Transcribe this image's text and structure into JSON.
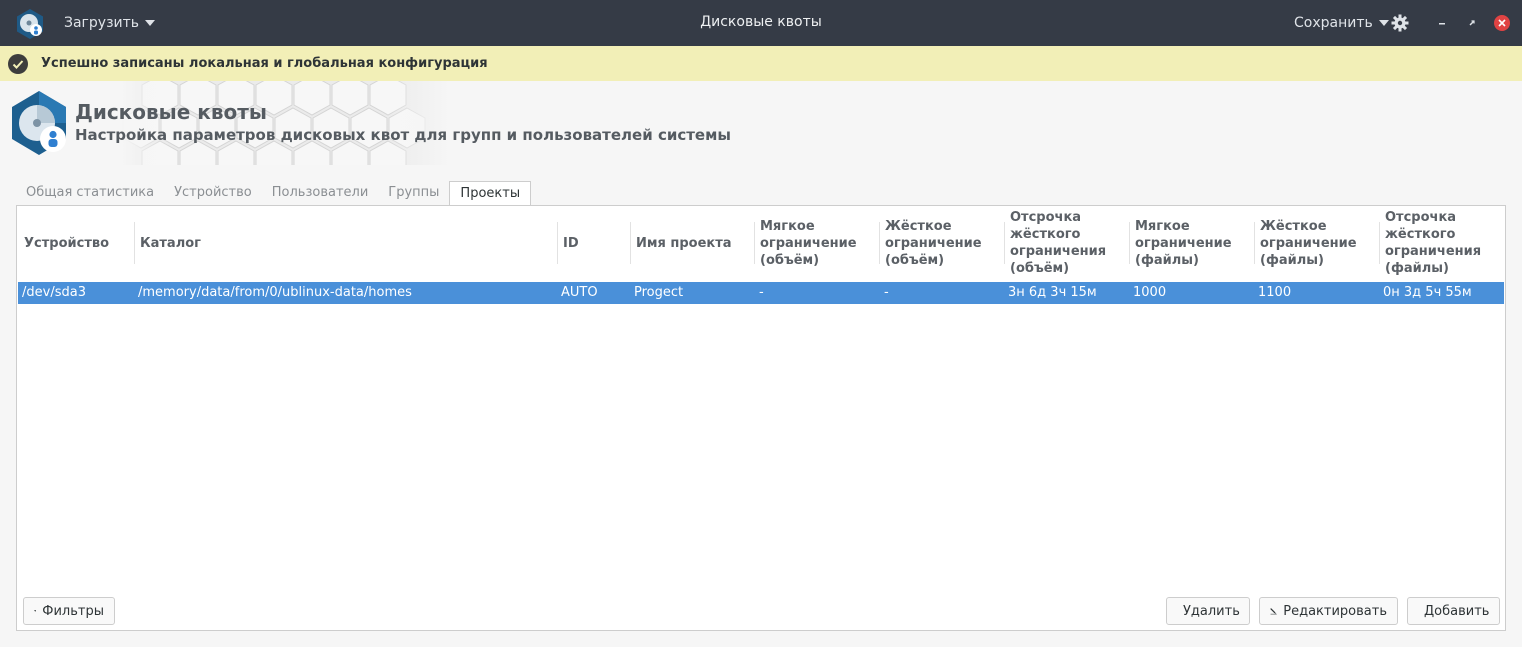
{
  "header": {
    "load_label": "Загрузить",
    "title": "Дисковые квоты",
    "save_label": "Сохранить"
  },
  "infobar": {
    "message": "Успешно записаны локальная и глобальная конфигурация"
  },
  "banner": {
    "title": "Дисковые квоты",
    "subtitle": "Настройка параметров дисковых квот для групп и пользователей системы"
  },
  "tabs": [
    {
      "label": "Общая статистика"
    },
    {
      "label": "Устройство"
    },
    {
      "label": "Пользователи"
    },
    {
      "label": "Группы"
    },
    {
      "label": "Проекты"
    }
  ],
  "table": {
    "columns": [
      {
        "l1": "Устройство"
      },
      {
        "l1": "Каталог"
      },
      {
        "l1": "ID"
      },
      {
        "l1": "Имя проекта"
      },
      {
        "l1": "Мягкое",
        "l2": "ограничение",
        "l3": "(объём)"
      },
      {
        "l1": "Жёсткое",
        "l2": "ограничение",
        "l3": "(объём)"
      },
      {
        "l1": "Отсрочка",
        "l2": "жёсткого",
        "l3": "ограничения",
        "l4": "(объём)"
      },
      {
        "l1": "Мягкое",
        "l2": "ограничение",
        "l3": "(файлы)"
      },
      {
        "l1": "Жёсткое",
        "l2": "ограничение",
        "l3": "(файлы)"
      },
      {
        "l1": "Отсрочка",
        "l2": "жёсткого",
        "l3": "ограничения",
        "l4": "(файлы)"
      }
    ],
    "rows": [
      [
        "/dev/sda3",
        "/memory/data/from/0/ublinux-data/homes",
        "AUTO",
        "Progect",
        "-",
        "-",
        "3н 6д 3ч 15м",
        "1000",
        "1100",
        "0н 3д 5ч 55м"
      ]
    ]
  },
  "buttons": {
    "filters": "Фильтры",
    "delete": "Удалить",
    "edit": "Редактировать",
    "add": "Добавить"
  },
  "colors": {
    "headerbar": "#353b46",
    "infobar": "#f2efb7",
    "selection": "#4a90d9",
    "delete_icon": "#cc0000"
  }
}
